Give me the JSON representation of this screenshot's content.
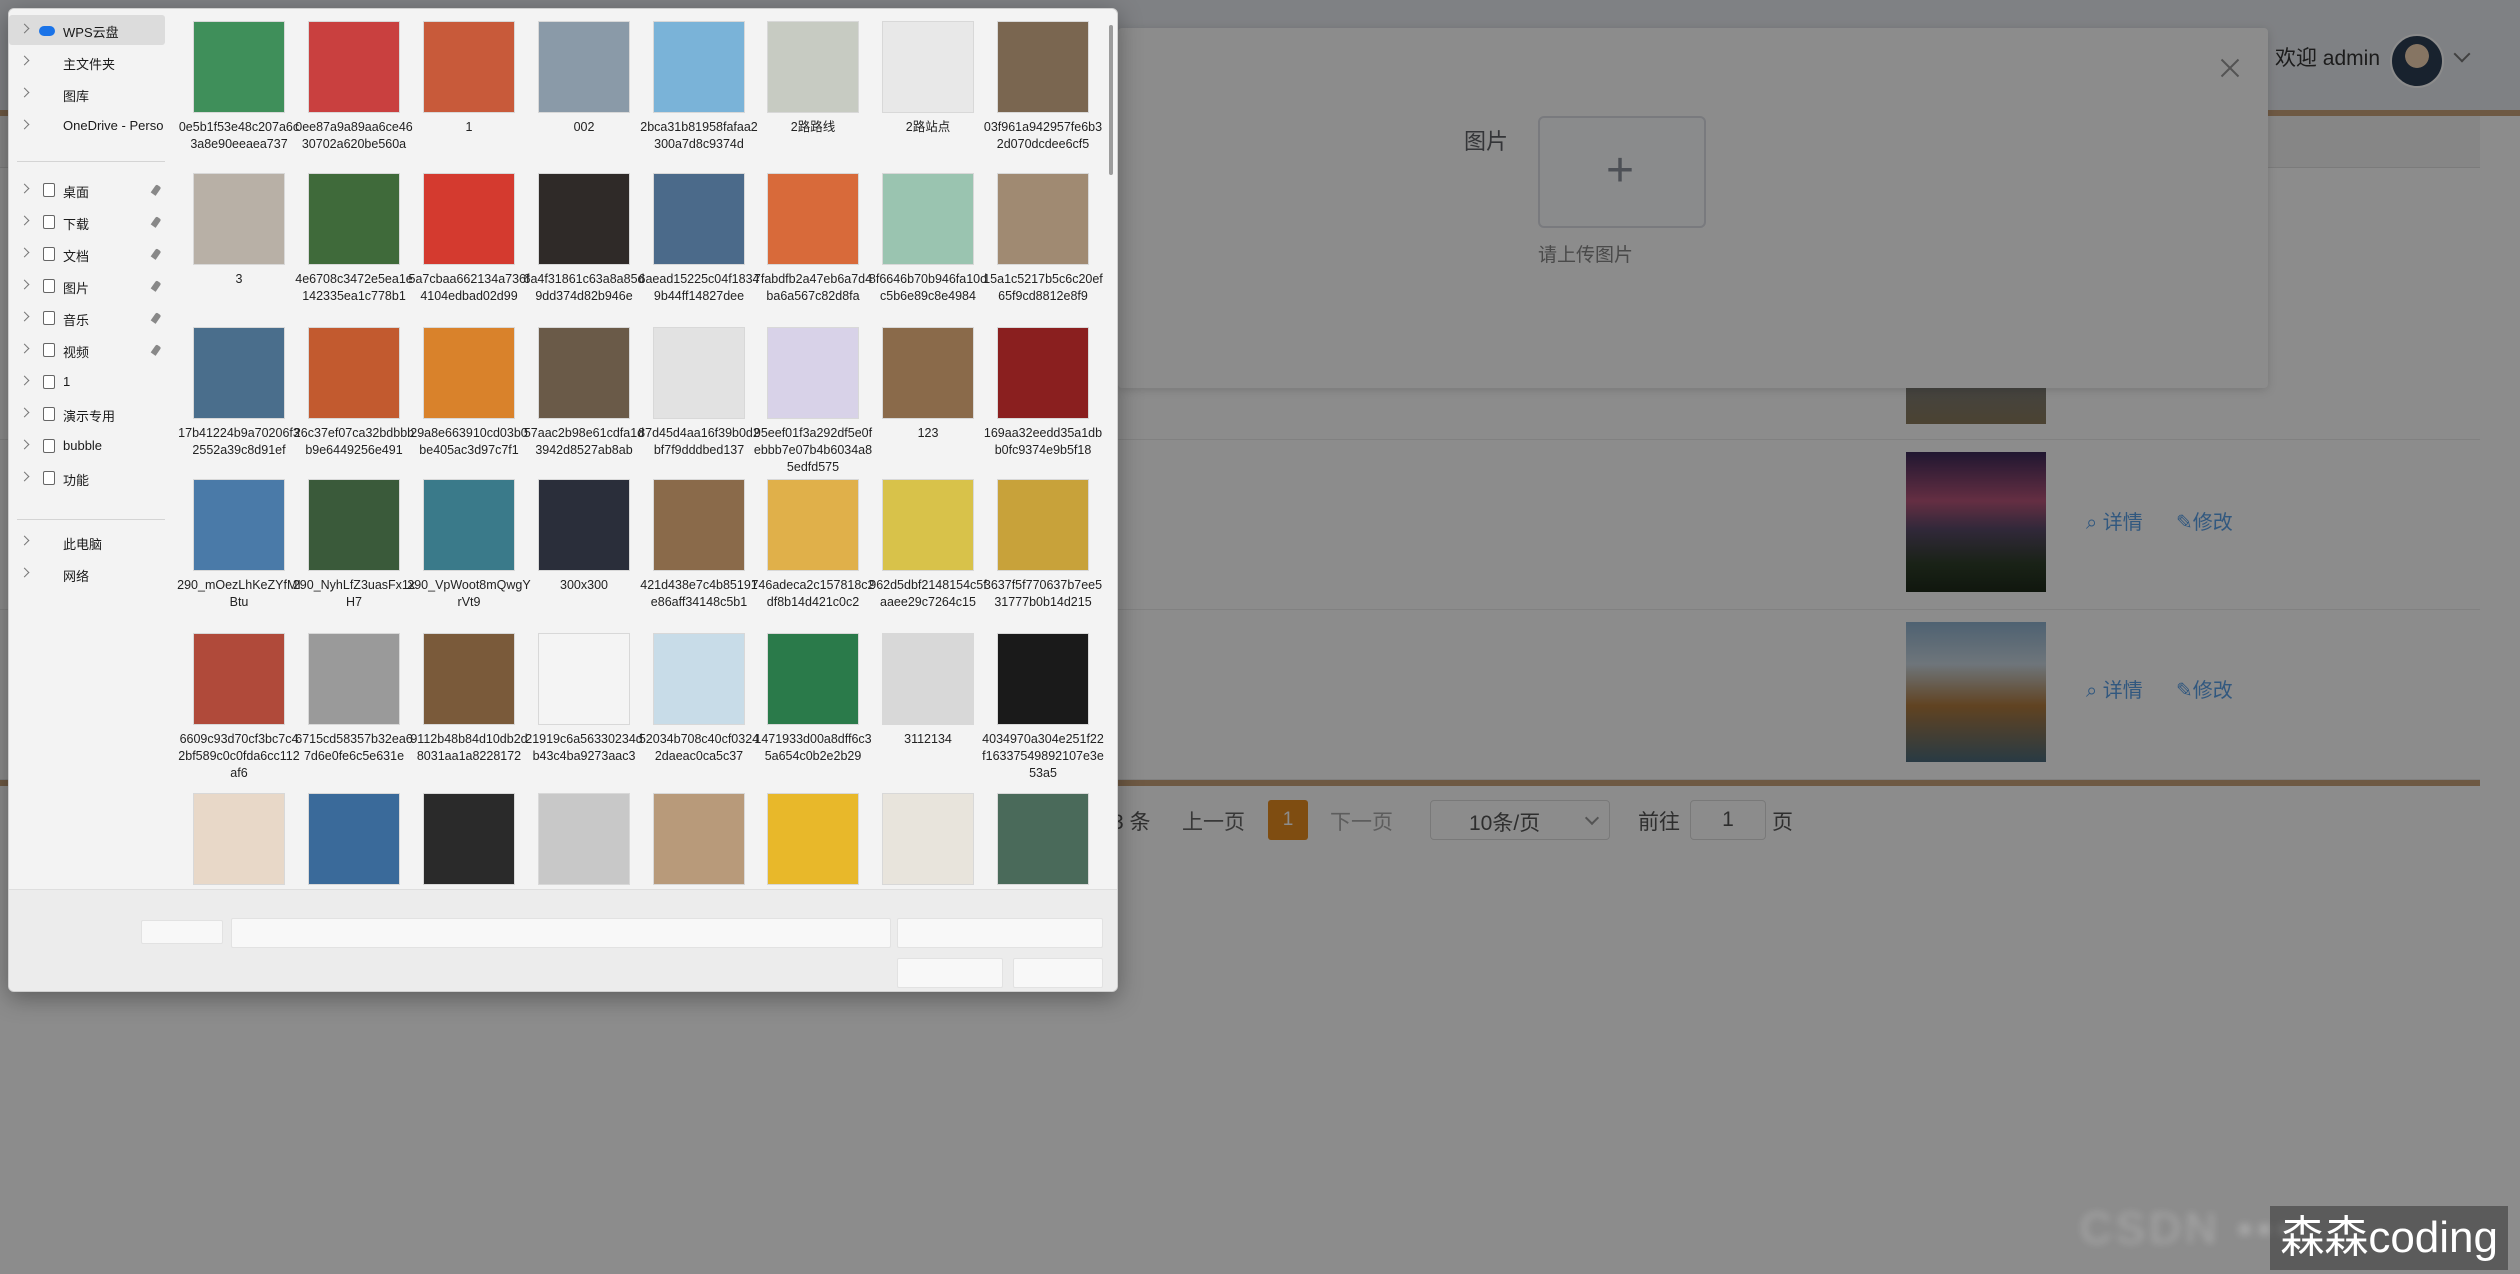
{
  "background": {
    "header": {
      "welcome": "欢迎 admin"
    },
    "rows": [
      {
        "detail_label": "详情",
        "edit_label": "修改"
      },
      {
        "detail_label": "详情",
        "edit_label": "修改"
      }
    ],
    "pagination": {
      "total": "3 条",
      "prev": "上一页",
      "current": "1",
      "next": "下一页",
      "page_size": "10条/页",
      "goto": "前往",
      "goto_value": "1",
      "page_unit": "页"
    },
    "dialog": {
      "field_label": "图片",
      "upload_plus": "+",
      "upload_hint": "请上传图片"
    },
    "watermark": "森森coding"
  },
  "picker": {
    "nav": [
      {
        "label": "WPS云盘",
        "icon": "cloud-icon",
        "selected": true
      },
      {
        "label": "主文件夹"
      },
      {
        "label": "图库"
      },
      {
        "label": "OneDrive - Perso"
      },
      {
        "label": "桌面",
        "pinned": true
      },
      {
        "label": "下载",
        "pinned": true
      },
      {
        "label": "文档",
        "pinned": true
      },
      {
        "label": "图片",
        "pinned": true
      },
      {
        "label": "音乐",
        "pinned": true
      },
      {
        "label": "视频",
        "pinned": true
      },
      {
        "label": "1"
      },
      {
        "label": "演示专用"
      },
      {
        "label": "bubble"
      },
      {
        "label": "功能"
      },
      {
        "label": "此电脑"
      },
      {
        "label": "网络"
      }
    ],
    "files": [
      {
        "name": "0e5b1f53e48c207a6c3a8e90eeaea737",
        "color": "#3f8f5a"
      },
      {
        "name": "0ee87a9a89aa6ce4630702a620be560a",
        "color": "#c9403f"
      },
      {
        "name": "1",
        "color": "#c85a3a"
      },
      {
        "name": "002",
        "color": "#8a9aa8"
      },
      {
        "name": "2bca31b81958fafaa2300a7d8c9374d",
        "color": "#7ab3d8"
      },
      {
        "name": "2路路线",
        "color": "#c7cbc2"
      },
      {
        "name": "2路站点",
        "color": "#e8e8e8"
      },
      {
        "name": "03f961a942957fe6b32d070dcdee6cf5",
        "color": "#7a6650"
      },
      {
        "name": "3",
        "color": "#b8b0a6"
      },
      {
        "name": "4e6708c3472e5ea1e142335ea1c778b1",
        "color": "#3f6a3a"
      },
      {
        "name": "5a7cbaa662134a736f4104edbad02d99",
        "color": "#d43a2f"
      },
      {
        "name": "6a4f31861c63a8a85d9dd374d82b946e",
        "color": "#2f2a28"
      },
      {
        "name": "6aead15225c04f18349b44ff14827dee",
        "color": "#4b6a8a"
      },
      {
        "name": "7fabdfb2a47eb6a7d4ba6a567c82d8fa",
        "color": "#d86a3a"
      },
      {
        "name": "8f6646b70b946fa10dc5b6e89c8e4984",
        "color": "#9ac4b0"
      },
      {
        "name": "15a1c5217b5c6c20ef65f9cd8812e8f9",
        "color": "#a08a72"
      },
      {
        "name": "17b41224b9a70206f32552a39c8d91ef",
        "color": "#4a6e8c"
      },
      {
        "name": "26c37ef07ca32bdbbbb9e6449256e491",
        "color": "#c25a2f"
      },
      {
        "name": "29a8e663910cd03b0be405ac3d97c7f1",
        "color": "#d9822b"
      },
      {
        "name": "57aac2b98e61cdfa1d3942d8527ab8ab",
        "color": "#6a5a48"
      },
      {
        "name": "87d45d4aa16f39b0d2bf7f9dddbed137",
        "color": "#e2e2e2"
      },
      {
        "name": "95eef01f3a292df5e0febbb7e07b4b6034a85edfd575",
        "color": "#d8d2e8"
      },
      {
        "name": "123",
        "color": "#8a6a4a"
      },
      {
        "name": "169aa32eedd35a1dbb0fc9374e9b5f18",
        "color": "#8a1f1f"
      },
      {
        "name": "290_mOezLhKeZYfMIBtu",
        "color": "#4a7aa8"
      },
      {
        "name": "290_NyhLfZ3uasFx1xH7",
        "color": "#3a5a3a"
      },
      {
        "name": "290_VpWoot8mQwgYrVt9",
        "color": "#3a7a8a"
      },
      {
        "name": "300x300",
        "color": "#2a2e3a"
      },
      {
        "name": "421d438e7c4b85191e86aff34148c5b1",
        "color": "#8a6a4a"
      },
      {
        "name": "746adeca2c157818c2df8b14d421c0c2",
        "color": "#e0b04a"
      },
      {
        "name": "962d5dbf2148154c5faaee29c7264c15",
        "color": "#d8c24a"
      },
      {
        "name": "3637f5f770637b7ee531777b0b14d215",
        "color": "#c8a23a"
      },
      {
        "name": "6609c93d70cf3bc7c42bf589c0c0fda6cc112af6",
        "color": "#b04a3a"
      },
      {
        "name": "6715cd58357b32ea67d6e0fe6c5e631e",
        "color": "#9a9a9a"
      },
      {
        "name": "9112b48b84d10db2d8031aa1a8228172",
        "color": "#7a5a3a"
      },
      {
        "name": "21919c6a56330234db43c4ba9273aac3",
        "color": "#f4f4f4"
      },
      {
        "name": "52034b708c40cf03242daeac0ca5c37",
        "color": "#c8dce8"
      },
      {
        "name": "1471933d00a8dff6c35a654c0b2e2b29",
        "color": "#2a7a4a"
      },
      {
        "name": "3112134",
        "color": "#d8d8d8"
      },
      {
        "name": "4034970a304e251f22f16337549892107e3e53a5",
        "color": "#1a1a1a"
      },
      {
        "name": "",
        "color": "#e8d8c8"
      },
      {
        "name": "",
        "color": "#3a6a9a"
      },
      {
        "name": "",
        "color": "#2a2a2a"
      },
      {
        "name": "",
        "color": "#c8c8c8"
      },
      {
        "name": "",
        "color": "#b89a7a"
      },
      {
        "name": "",
        "color": "#e8b82a"
      },
      {
        "name": "",
        "color": "#e8e4dc"
      },
      {
        "name": "",
        "color": "#4a6a5a"
      }
    ]
  }
}
